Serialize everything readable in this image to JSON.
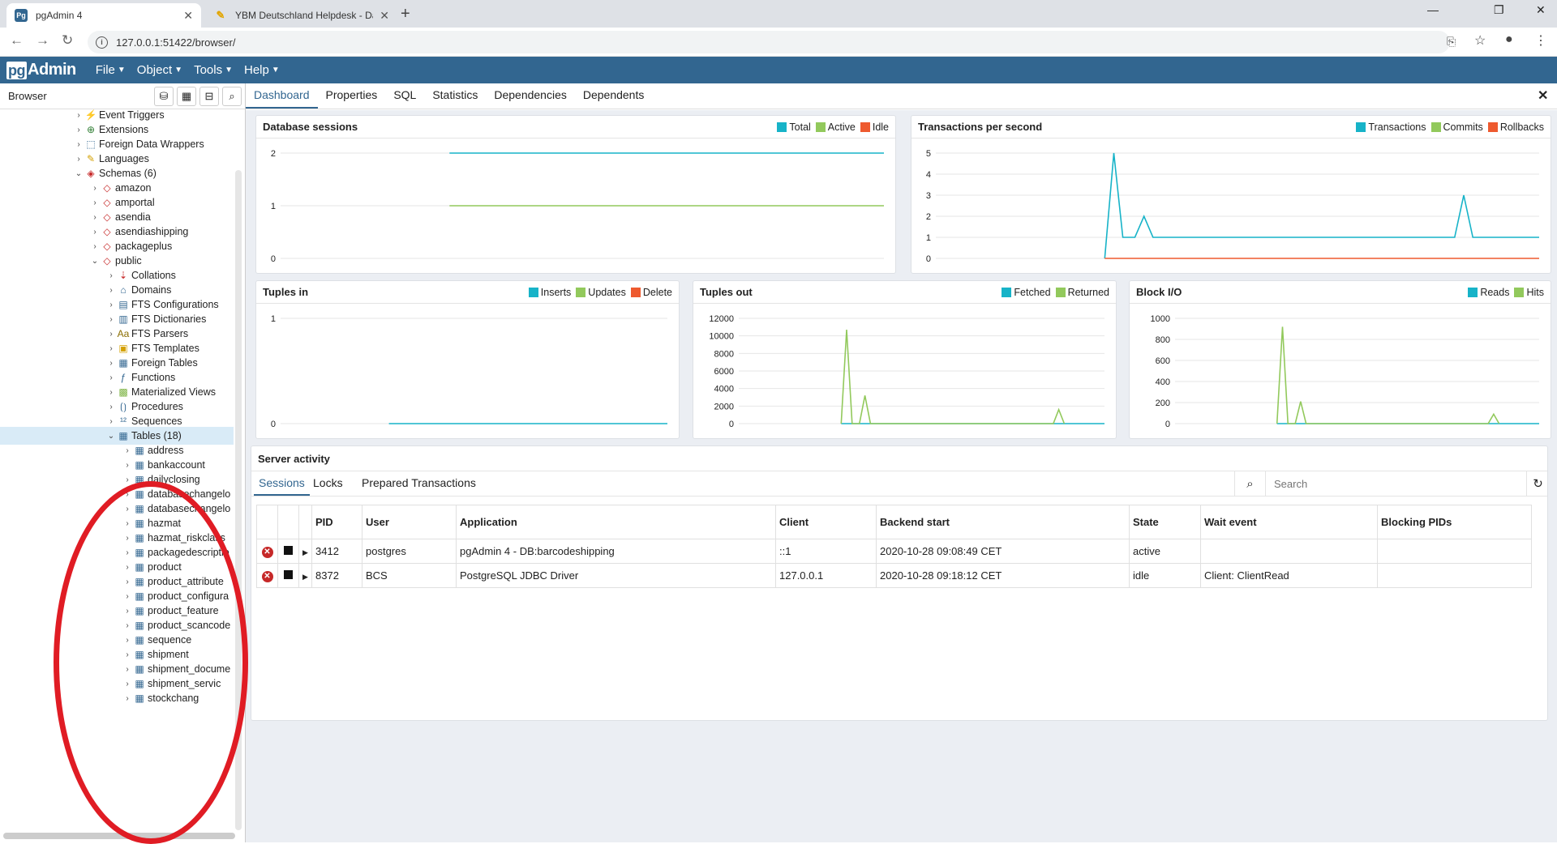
{
  "browser": {
    "tabs": [
      {
        "title": "pgAdmin 4",
        "favicon": "Pg"
      },
      {
        "title": "YBM Deutschland Helpdesk - Da",
        "favicon": "helpdesk-icon"
      }
    ],
    "url": "127.0.0.1:51422/browser/"
  },
  "app": {
    "logo_pg": "pg",
    "logo_text": "Admin",
    "menu": [
      "File",
      "Object",
      "Tools",
      "Help"
    ]
  },
  "sidebar": {
    "title": "Browser",
    "tree": [
      {
        "label": "Event Triggers",
        "icon": "event-trigger-icon",
        "depth": 0,
        "expanded": false
      },
      {
        "label": "Extensions",
        "icon": "extension-icon",
        "depth": 0,
        "expanded": false
      },
      {
        "label": "Foreign Data Wrappers",
        "icon": "fdw-icon",
        "depth": 0,
        "expanded": false
      },
      {
        "label": "Languages",
        "icon": "language-icon",
        "depth": 0,
        "expanded": false
      },
      {
        "label": "Schemas (6)",
        "icon": "schemas-icon",
        "depth": 0,
        "expanded": true
      },
      {
        "label": "amazon",
        "icon": "schema-icon",
        "depth": 1,
        "expanded": false
      },
      {
        "label": "amportal",
        "icon": "schema-icon",
        "depth": 1,
        "expanded": false
      },
      {
        "label": "asendia",
        "icon": "schema-icon",
        "depth": 1,
        "expanded": false
      },
      {
        "label": "asendiashipping",
        "icon": "schema-icon",
        "depth": 1,
        "expanded": false
      },
      {
        "label": "packageplus",
        "icon": "schema-icon",
        "depth": 1,
        "expanded": false
      },
      {
        "label": "public",
        "icon": "schema-icon",
        "depth": 1,
        "expanded": true
      },
      {
        "label": "Collations",
        "icon": "collation-icon",
        "depth": 2,
        "expanded": false
      },
      {
        "label": "Domains",
        "icon": "domain-icon",
        "depth": 2,
        "expanded": false
      },
      {
        "label": "FTS Configurations",
        "icon": "fts-config-icon",
        "depth": 2,
        "expanded": false
      },
      {
        "label": "FTS Dictionaries",
        "icon": "fts-dict-icon",
        "depth": 2,
        "expanded": false
      },
      {
        "label": "FTS Parsers",
        "icon": "fts-parser-icon",
        "depth": 2,
        "expanded": false
      },
      {
        "label": "FTS Templates",
        "icon": "fts-template-icon",
        "depth": 2,
        "expanded": false
      },
      {
        "label": "Foreign Tables",
        "icon": "foreign-table-icon",
        "depth": 2,
        "expanded": false
      },
      {
        "label": "Functions",
        "icon": "function-icon",
        "depth": 2,
        "expanded": false
      },
      {
        "label": "Materialized Views",
        "icon": "mview-icon",
        "depth": 2,
        "expanded": false
      },
      {
        "label": "Procedures",
        "icon": "procedure-icon",
        "depth": 2,
        "expanded": false
      },
      {
        "label": "Sequences",
        "icon": "sequence-icon",
        "depth": 2,
        "expanded": false
      },
      {
        "label": "Tables (18)",
        "icon": "table-icon",
        "depth": 2,
        "expanded": true,
        "selected": true
      },
      {
        "label": "address",
        "icon": "table-icon",
        "depth": 3,
        "expanded": false
      },
      {
        "label": "bankaccount",
        "icon": "table-icon",
        "depth": 3,
        "expanded": false
      },
      {
        "label": "dailyclosing",
        "icon": "table-icon",
        "depth": 3,
        "expanded": false
      },
      {
        "label": "databasechangelo",
        "icon": "table-icon",
        "depth": 3,
        "expanded": false
      },
      {
        "label": "databasechangelo",
        "icon": "table-icon",
        "depth": 3,
        "expanded": false
      },
      {
        "label": "hazmat",
        "icon": "table-icon",
        "depth": 3,
        "expanded": false
      },
      {
        "label": "hazmat_riskclass",
        "icon": "table-icon",
        "depth": 3,
        "expanded": false
      },
      {
        "label": "packagedescriptio",
        "icon": "table-icon",
        "depth": 3,
        "expanded": false
      },
      {
        "label": "product",
        "icon": "table-icon",
        "depth": 3,
        "expanded": false
      },
      {
        "label": "product_attribute",
        "icon": "table-icon",
        "depth": 3,
        "expanded": false
      },
      {
        "label": "product_configura",
        "icon": "table-icon",
        "depth": 3,
        "expanded": false
      },
      {
        "label": "product_feature",
        "icon": "table-icon",
        "depth": 3,
        "expanded": false
      },
      {
        "label": "product_scancode",
        "icon": "table-icon",
        "depth": 3,
        "expanded": false
      },
      {
        "label": "sequence",
        "icon": "table-icon",
        "depth": 3,
        "expanded": false
      },
      {
        "label": "shipment",
        "icon": "table-icon",
        "depth": 3,
        "expanded": false
      },
      {
        "label": "shipment_docume",
        "icon": "table-icon",
        "depth": 3,
        "expanded": false
      },
      {
        "label": "shipment_servic",
        "icon": "table-icon",
        "depth": 3,
        "expanded": false
      },
      {
        "label": "stockchang",
        "icon": "table-icon",
        "depth": 3,
        "expanded": false
      }
    ]
  },
  "main_tabs": [
    "Dashboard",
    "Properties",
    "SQL",
    "Statistics",
    "Dependencies",
    "Dependents"
  ],
  "colors": {
    "teal": "#17b3c8",
    "green": "#92c95c",
    "red": "#ee5a2f",
    "brand": "#326690"
  },
  "chart_data": [
    {
      "type": "line",
      "title": "Database sessions",
      "ylim": [
        0,
        2
      ],
      "yticks": [
        "2",
        "1",
        "0"
      ],
      "x": [
        0,
        1
      ],
      "series": [
        {
          "name": "Total",
          "color": "#17b3c8",
          "points": [
            [
              0.28,
              2
            ],
            [
              1,
              2
            ]
          ]
        },
        {
          "name": "Active",
          "color": "#92c95c",
          "points": [
            [
              0.28,
              1
            ],
            [
              1,
              1
            ]
          ]
        },
        {
          "name": "Idle",
          "color": "#ee5a2f",
          "points": []
        }
      ]
    },
    {
      "type": "line",
      "title": "Transactions per second",
      "ylim": [
        0,
        5
      ],
      "yticks": [
        "5",
        "4",
        "3",
        "2",
        "1",
        "0"
      ],
      "series": [
        {
          "name": "Transactions",
          "color": "#17b3c8",
          "points": [
            [
              0.28,
              0
            ],
            [
              0.295,
              5
            ],
            [
              0.31,
              1
            ],
            [
              0.33,
              1
            ],
            [
              0.345,
              2
            ],
            [
              0.36,
              1
            ],
            [
              0.86,
              1
            ],
            [
              0.875,
              3
            ],
            [
              0.89,
              1
            ],
            [
              1,
              1
            ]
          ]
        },
        {
          "name": "Commits",
          "color": "#92c95c",
          "points": []
        },
        {
          "name": "Rollbacks",
          "color": "#ee5a2f",
          "points": [
            [
              0.28,
              0
            ],
            [
              1,
              0
            ]
          ]
        }
      ]
    },
    {
      "type": "line",
      "title": "Tuples in",
      "ylim": [
        0,
        1
      ],
      "yticks": [
        "1",
        "0"
      ],
      "series": [
        {
          "name": "Inserts",
          "color": "#17b3c8",
          "points": [
            [
              0.28,
              0
            ],
            [
              1,
              0
            ]
          ]
        },
        {
          "name": "Updates",
          "color": "#92c95c",
          "points": []
        },
        {
          "name": "Delete",
          "color": "#ee5a2f",
          "points": []
        }
      ]
    },
    {
      "type": "line",
      "title": "Tuples out",
      "ylim": [
        0,
        12000
      ],
      "yticks": [
        "12000",
        "10000",
        "8000",
        "6000",
        "4000",
        "2000",
        "0"
      ],
      "series": [
        {
          "name": "Fetched",
          "color": "#17b3c8",
          "points": [
            [
              0.28,
              0
            ],
            [
              1,
              0
            ]
          ]
        },
        {
          "name": "Returned",
          "color": "#92c95c",
          "points": [
            [
              0.28,
              0
            ],
            [
              0.295,
              10700
            ],
            [
              0.31,
              0
            ],
            [
              0.33,
              0
            ],
            [
              0.345,
              3200
            ],
            [
              0.36,
              0
            ],
            [
              0.86,
              0
            ],
            [
              0.875,
              1600
            ],
            [
              0.89,
              0
            ]
          ]
        }
      ]
    },
    {
      "type": "line",
      "title": "Block I/O",
      "ylim": [
        0,
        1000
      ],
      "yticks": [
        "1000",
        "800",
        "600",
        "400",
        "200",
        "0"
      ],
      "series": [
        {
          "name": "Reads",
          "color": "#17b3c8",
          "points": [
            [
              0.28,
              0
            ],
            [
              1,
              0
            ]
          ]
        },
        {
          "name": "Hits",
          "color": "#92c95c",
          "points": [
            [
              0.28,
              0
            ],
            [
              0.295,
              920
            ],
            [
              0.31,
              0
            ],
            [
              0.33,
              0
            ],
            [
              0.345,
              210
            ],
            [
              0.36,
              0
            ],
            [
              0.86,
              0
            ],
            [
              0.875,
              90
            ],
            [
              0.89,
              0
            ]
          ]
        }
      ]
    }
  ],
  "activity": {
    "title": "Server activity",
    "tabs": [
      "Sessions",
      "Locks",
      "Prepared Transactions"
    ],
    "search_placeholder": "Search",
    "columns": [
      "PID",
      "User",
      "Application",
      "Client",
      "Backend start",
      "State",
      "Wait event",
      "Blocking PIDs"
    ],
    "rows": [
      [
        "3412",
        "postgres",
        "pgAdmin 4 - DB:barcodeshipping",
        "::1",
        "2020-10-28 09:08:49 CET",
        "active",
        "",
        ""
      ],
      [
        "8372",
        "BCS",
        "PostgreSQL JDBC Driver",
        "127.0.0.1",
        "2020-10-28 09:18:12 CET",
        "idle",
        "Client: ClientRead",
        ""
      ]
    ]
  }
}
